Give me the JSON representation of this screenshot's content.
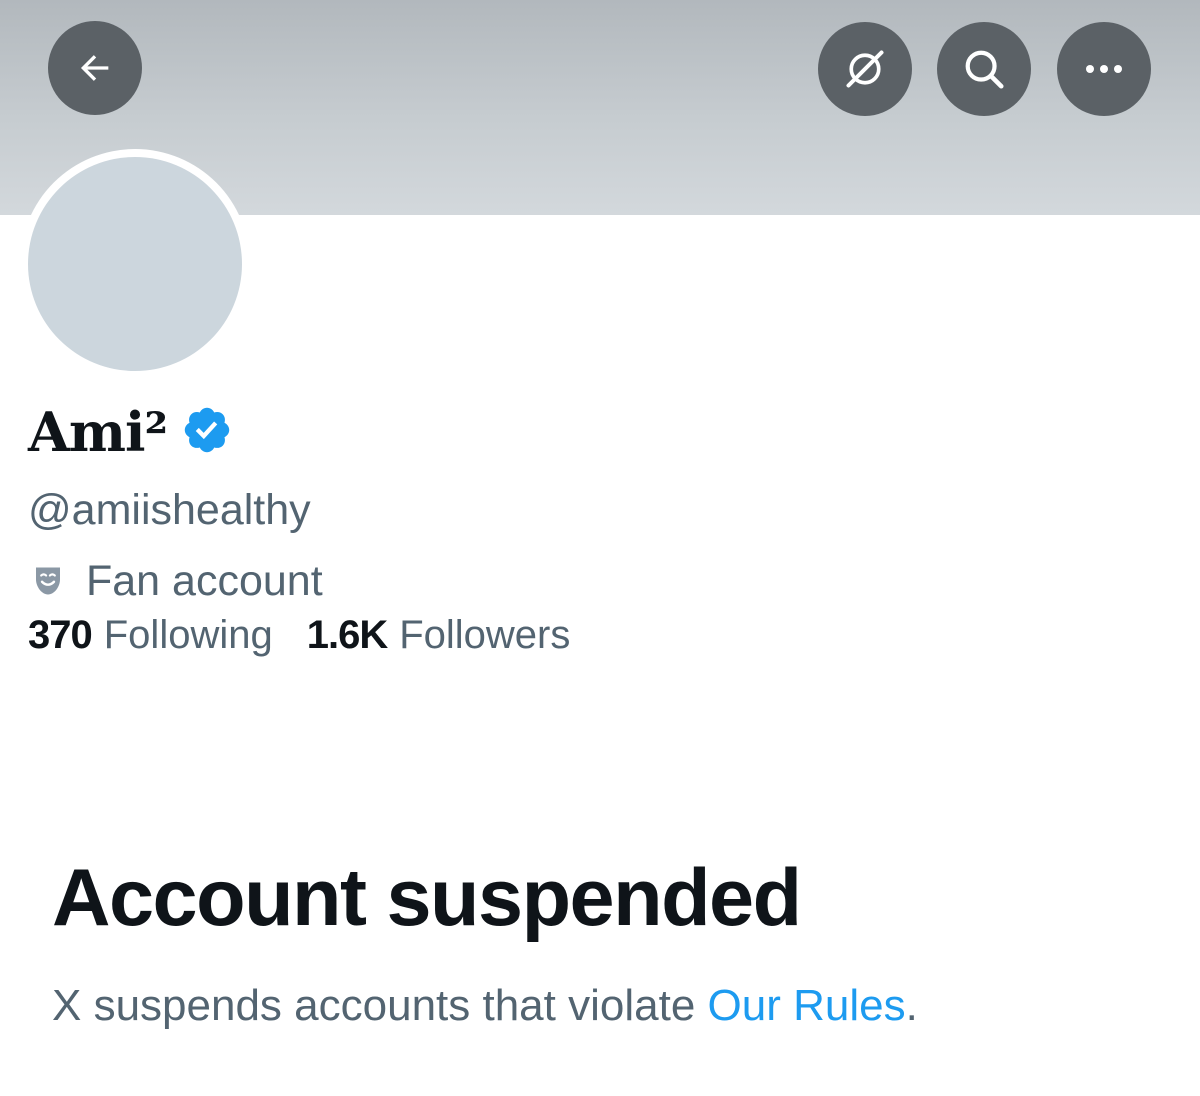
{
  "header": {
    "back_icon": "arrow-left-icon",
    "grok_icon": "grok-icon",
    "search_icon": "search-icon",
    "more_icon": "ellipsis-icon",
    "button_color": "#5b6166",
    "banner_color": "#c6ccd0"
  },
  "profile": {
    "display_name": "Ami²",
    "verified": true,
    "verified_color": "#1d9bf0",
    "handle": "@amiishealthy",
    "category": "Fan account",
    "category_icon": "theater-mask-icon",
    "following_count": "370",
    "following_label": "Following",
    "followers_count": "1.6K",
    "followers_label": "Followers"
  },
  "suspension": {
    "title": "Account suspended",
    "description_prefix": "X suspends accounts that violate ",
    "rules_link": "Our Rules",
    "description_suffix": ".",
    "link_color": "#1d9bf0"
  }
}
